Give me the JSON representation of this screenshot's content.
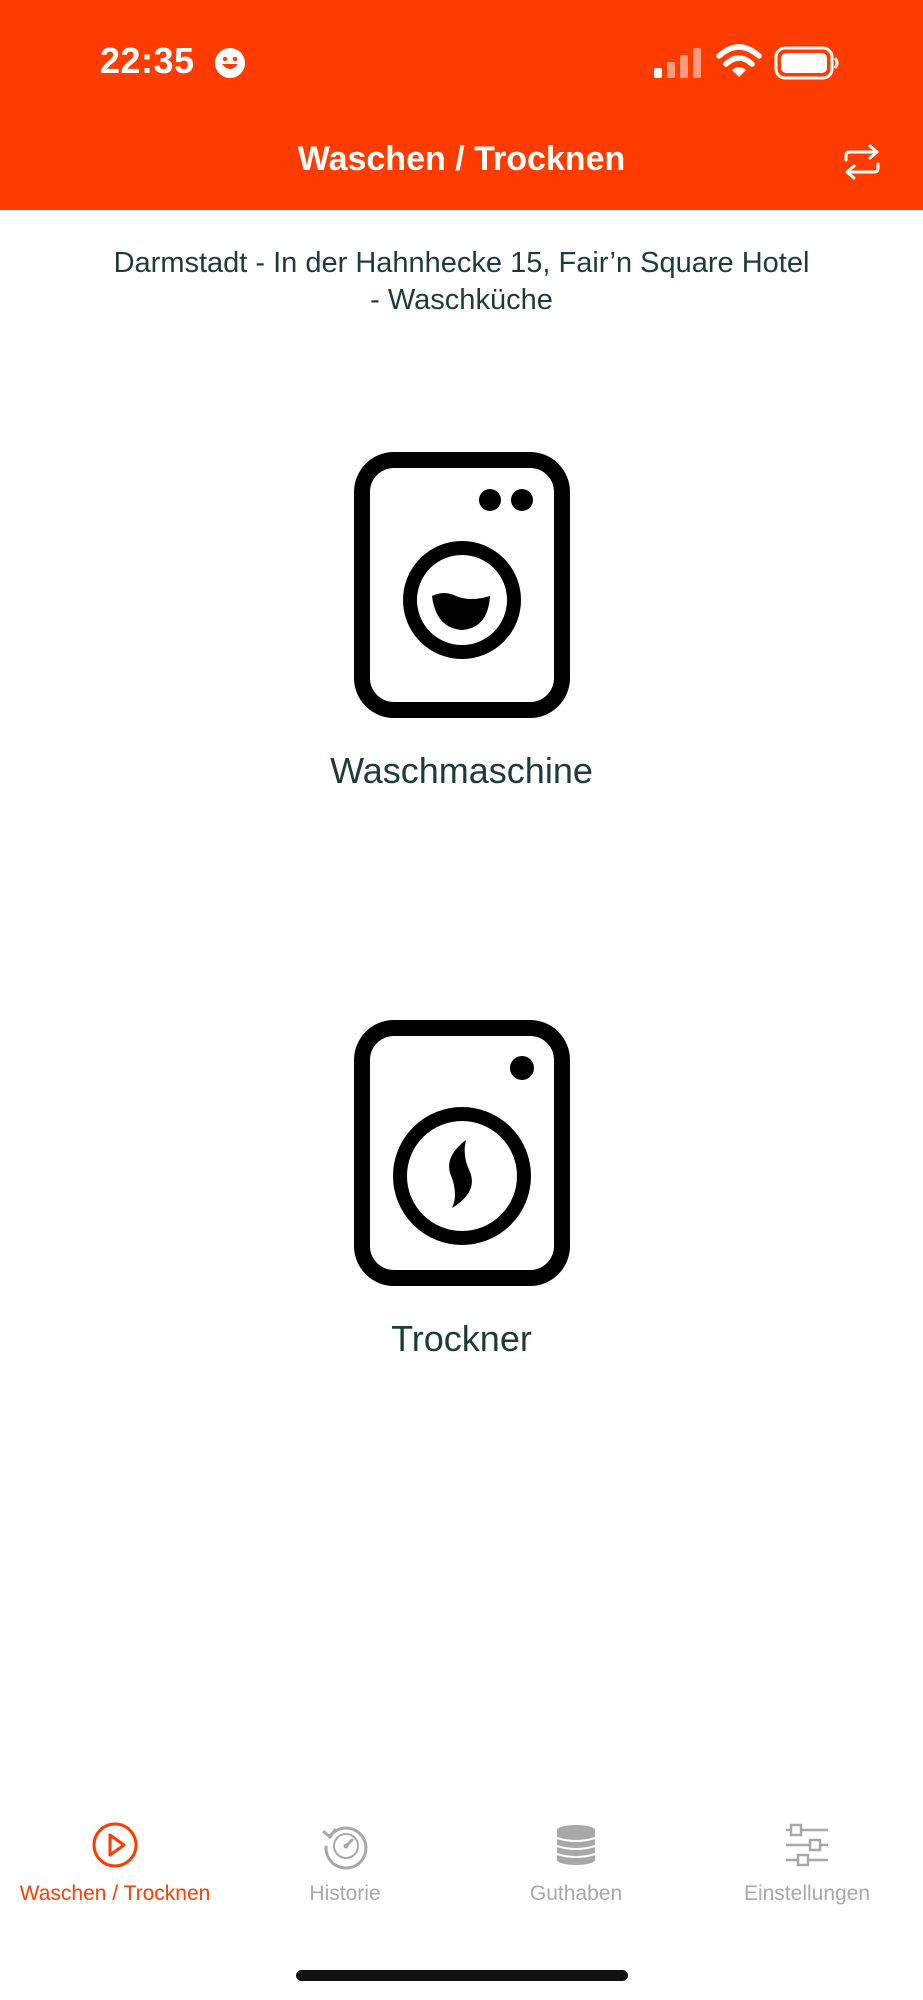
{
  "colors": {
    "accent": "#ff3c00",
    "text": "#1e3b3b",
    "inactive": "#a8a8a8"
  },
  "status_bar": {
    "time": "22:35",
    "icons": [
      "smiley-face-icon",
      "signal-icon",
      "wifi-icon",
      "battery-icon"
    ]
  },
  "header": {
    "title": "Waschen / Trocknen",
    "swap_icon": "swap-arrows-icon"
  },
  "location": {
    "line1": "Darmstadt - In der Hahnhecke 15, Fair’n Square Hotel",
    "line2": "- Waschküche"
  },
  "machines": [
    {
      "label": "Waschmaschine",
      "icon": "washing-machine-icon"
    },
    {
      "label": "Trockner",
      "icon": "dryer-icon"
    }
  ],
  "tabs": [
    {
      "label": "Waschen / Trocknen",
      "icon": "play-circle-icon",
      "active": true
    },
    {
      "label": "Historie",
      "icon": "history-icon",
      "active": false
    },
    {
      "label": "Guthaben",
      "icon": "coins-icon",
      "active": false
    },
    {
      "label": "Einstellungen",
      "icon": "sliders-icon",
      "active": false
    }
  ]
}
